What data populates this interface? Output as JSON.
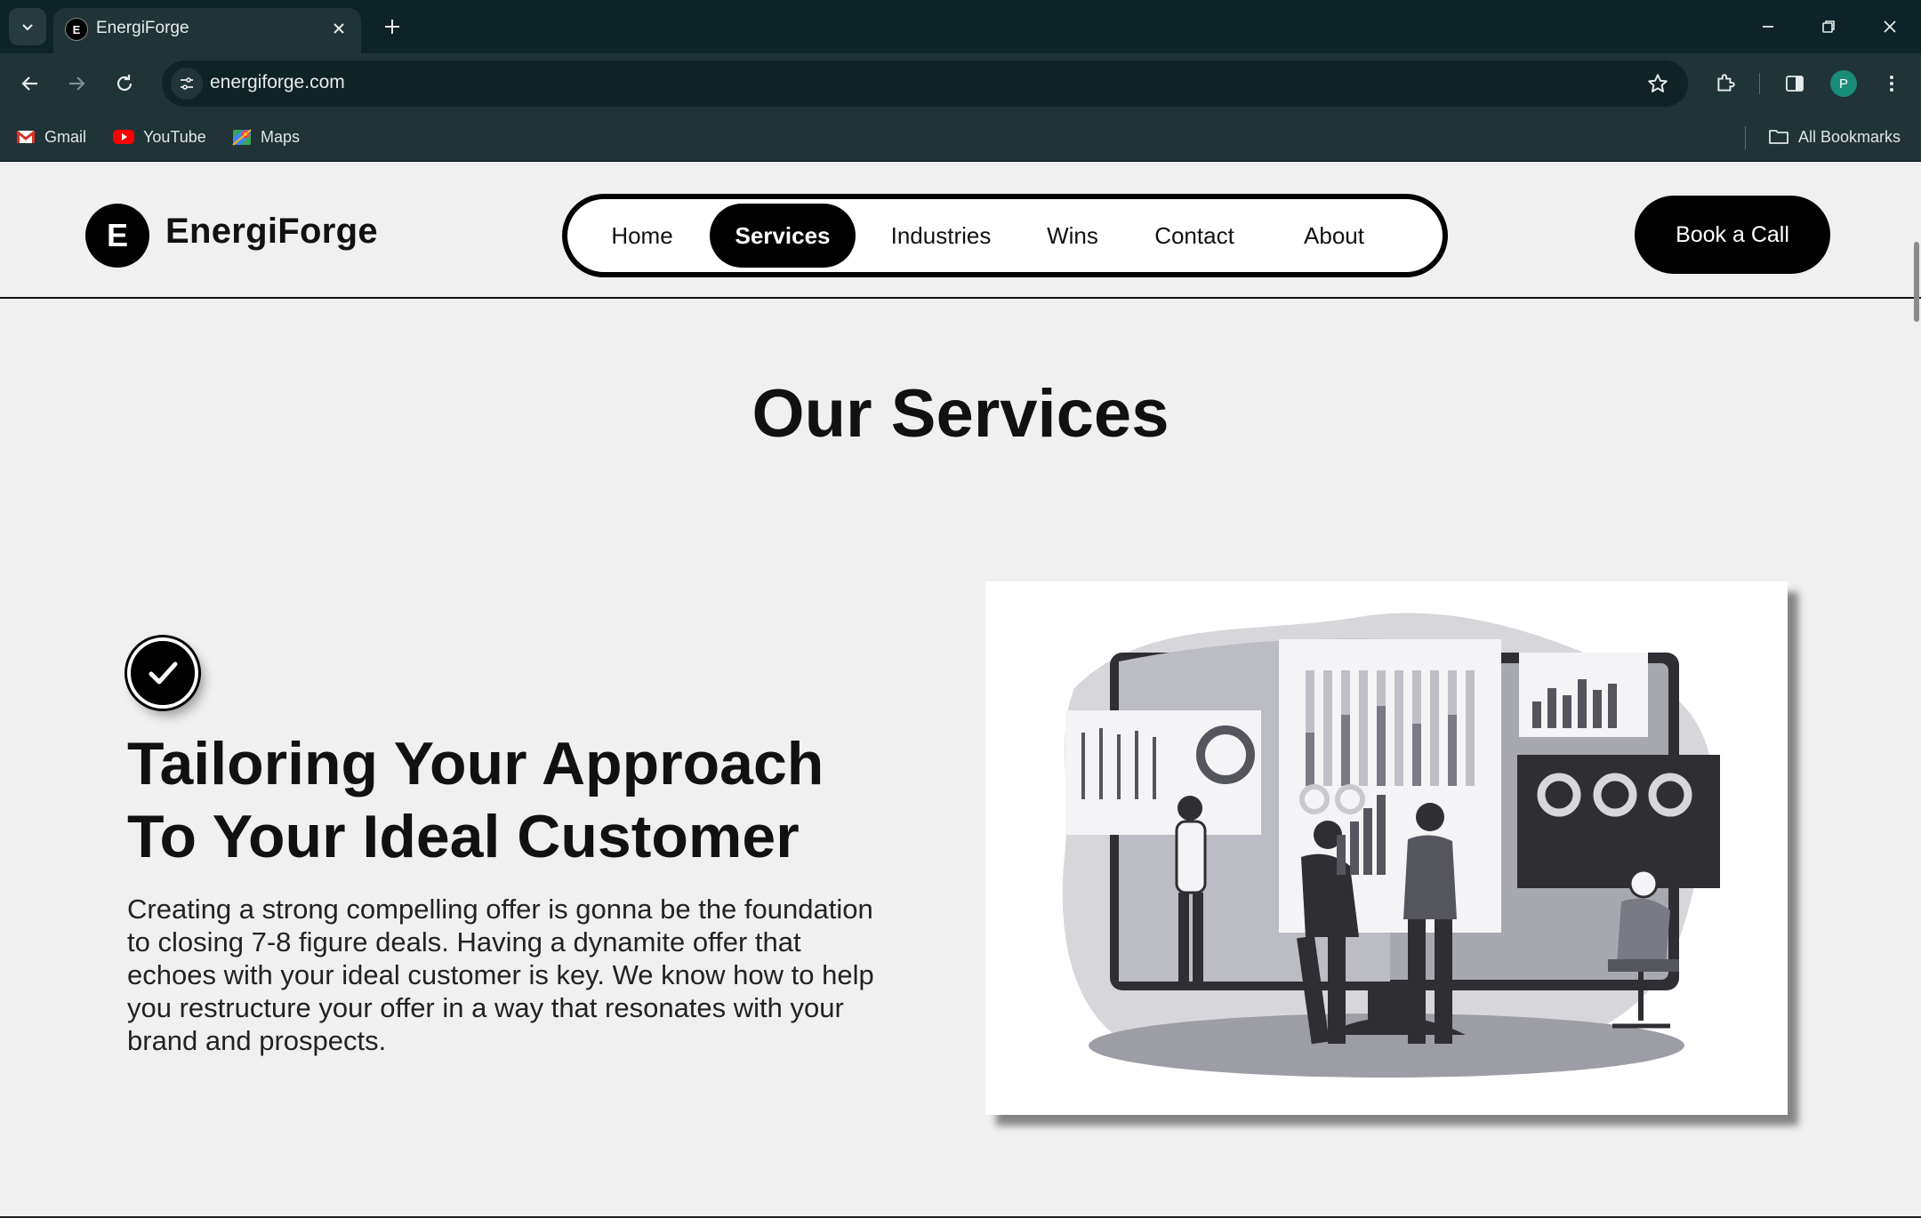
{
  "browser": {
    "tab_title": "EnergiForge",
    "tab_favicon_letter": "E",
    "url": "energiforge.com",
    "profile_initial": "P",
    "bookmarks": [
      {
        "label": "Gmail",
        "icon": "gmail-icon"
      },
      {
        "label": "YouTube",
        "icon": "youtube-icon"
      },
      {
        "label": "Maps",
        "icon": "maps-icon"
      }
    ],
    "all_bookmarks_label": "All Bookmarks"
  },
  "site": {
    "logo_letter": "E",
    "logo_text": "EnergiForge",
    "nav": [
      {
        "label": "Home",
        "active": false
      },
      {
        "label": "Services",
        "active": true
      },
      {
        "label": "Industries",
        "active": false
      },
      {
        "label": "Wins",
        "active": false
      },
      {
        "label": "Contact",
        "active": false
      },
      {
        "label": "About",
        "active": false
      }
    ],
    "cta_label": "Book a Call"
  },
  "main": {
    "section_title": "Our Services",
    "service": {
      "icon": "checkmark-icon",
      "title_line1": "Tailoring Your Approach",
      "title_line2": "To Your Ideal Customer",
      "body": "Creating a strong compelling offer is gonna be the foundation to closing 7-8 figure deals. Having a dynamite offer that echoes with your ideal customer is key. We know how to help you restructure your offer in a way that resonates with your brand and prospects."
    }
  },
  "colors": {
    "chrome_dark": "#0e2328",
    "chrome_toolbar": "#203337",
    "page_bg": "#f0f0f0",
    "accent": "#000000",
    "profile_green": "#1a8c7a"
  }
}
